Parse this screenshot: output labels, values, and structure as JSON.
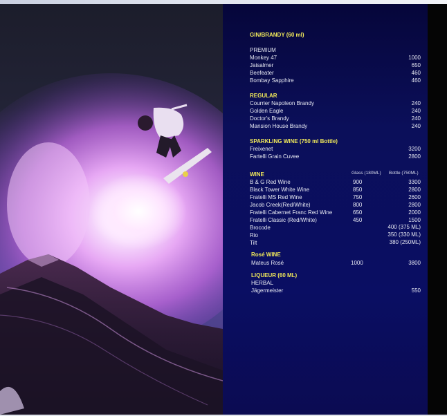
{
  "menu": {
    "gin": {
      "heading": "GIN/BRANDY (60 ml)",
      "subheading": "PREMIUM",
      "items": [
        {
          "name": "Monkey 47",
          "price": "1000"
        },
        {
          "name": "Jaisalmer",
          "price": "650"
        },
        {
          "name": "Beefeater",
          "price": "460"
        },
        {
          "name": "Bombay Sapphire",
          "price": "460"
        }
      ]
    },
    "regular": {
      "heading": "REGULAR",
      "items": [
        {
          "name": "Courrier Napoleon Brandy",
          "price": "240"
        },
        {
          "name": "Golden Eagle",
          "price": "240"
        },
        {
          "name": "Doctor's Brandy",
          "price": "240"
        },
        {
          "name": "Mansion House Brandy",
          "price": "240"
        }
      ]
    },
    "sparkling": {
      "heading": "SPARKLING WINE (750 ml Bottle)",
      "items": [
        {
          "name": "Freixenet",
          "price": "3200"
        },
        {
          "name": "Fartelli Grain Cuvee",
          "price": "2800"
        }
      ]
    },
    "wine": {
      "heading": "WINE",
      "col_glass": "Glass (180ML)",
      "col_bottle": "Bottle (750ML)",
      "items": [
        {
          "name": "B & G Red Wine",
          "glass": "900",
          "bottle": "3300"
        },
        {
          "name": "Black Tower White Wine",
          "glass": "850",
          "bottle": "2800"
        },
        {
          "name": "Fratelli MS Red Wine",
          "glass": "750",
          "bottle": "2600"
        },
        {
          "name": "Jacob Creek(Red/White)",
          "glass": "800",
          "bottle": "2800"
        },
        {
          "name": "Fratelli Cabernet Franc Red Wine",
          "glass": "650",
          "bottle": "2000"
        },
        {
          "name": "Fratelli Classic (Red/White)",
          "glass": "450",
          "bottle": "1500"
        },
        {
          "name": "Brocode",
          "glass": "",
          "bottle": "400 (375 ML)"
        },
        {
          "name": "Rio",
          "glass": "",
          "bottle": "350 (330 ML)"
        },
        {
          "name": "Tilt",
          "glass": "",
          "bottle": "380 (250ML)"
        }
      ]
    },
    "rose": {
      "heading": "Rosé WINE",
      "items": [
        {
          "name": "Mateus Rosé",
          "glass": "1000",
          "bottle": "3800"
        }
      ]
    },
    "liqueur": {
      "heading": "LIQUEUR (60 ML)",
      "subheading": "HERBAL",
      "items": [
        {
          "name": "Jägermeister",
          "price": "550"
        }
      ]
    }
  },
  "colors": {
    "heading": "#f0e85a",
    "text": "#e6e8f2",
    "panel": "#0a0e5e"
  }
}
